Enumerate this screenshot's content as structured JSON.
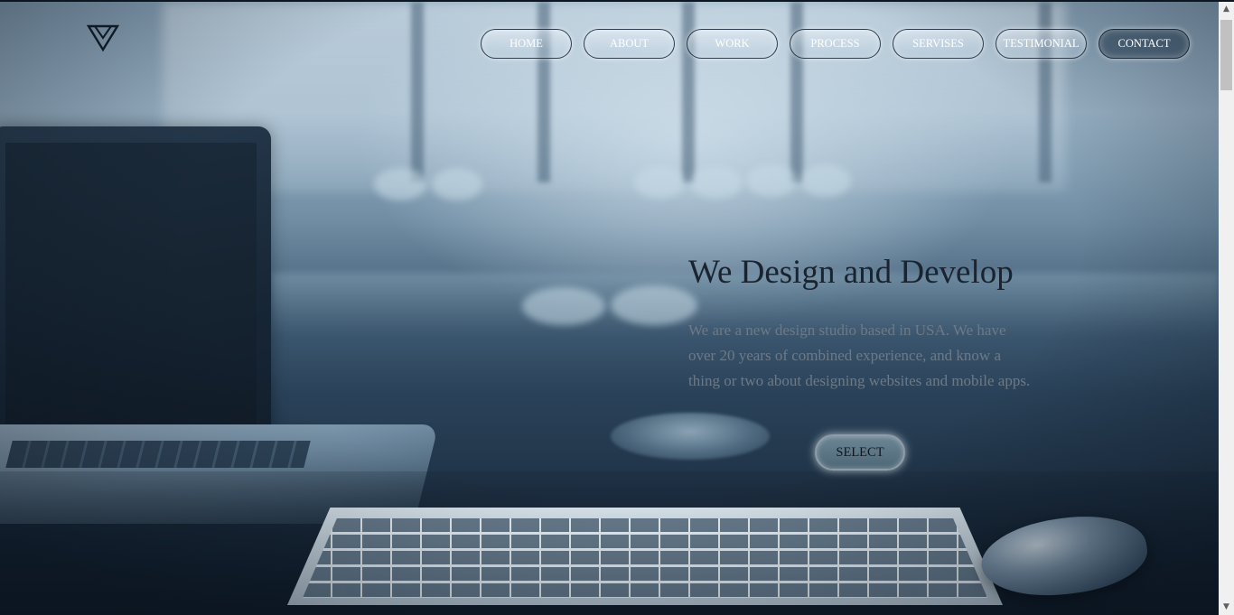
{
  "nav": {
    "items": [
      {
        "label": "HOME"
      },
      {
        "label": "ABOUT"
      },
      {
        "label": "WORK"
      },
      {
        "label": "PROCESS"
      },
      {
        "label": "SERVISES"
      },
      {
        "label": "TESTIMONIAL"
      },
      {
        "label": "CONTACT"
      }
    ]
  },
  "logo": {
    "icon": "triangle-logo-icon"
  },
  "hero": {
    "title": "We Design and Develop",
    "text": "We are a new design studio based in USA. We have over 20 years of combined experience, and know a thing or two about designing websites and mobile apps.",
    "button_label": "SELECT"
  },
  "colors": {
    "title": "#1a2430",
    "body_text": "#6d7a86",
    "nav_text": "#ffffff"
  }
}
